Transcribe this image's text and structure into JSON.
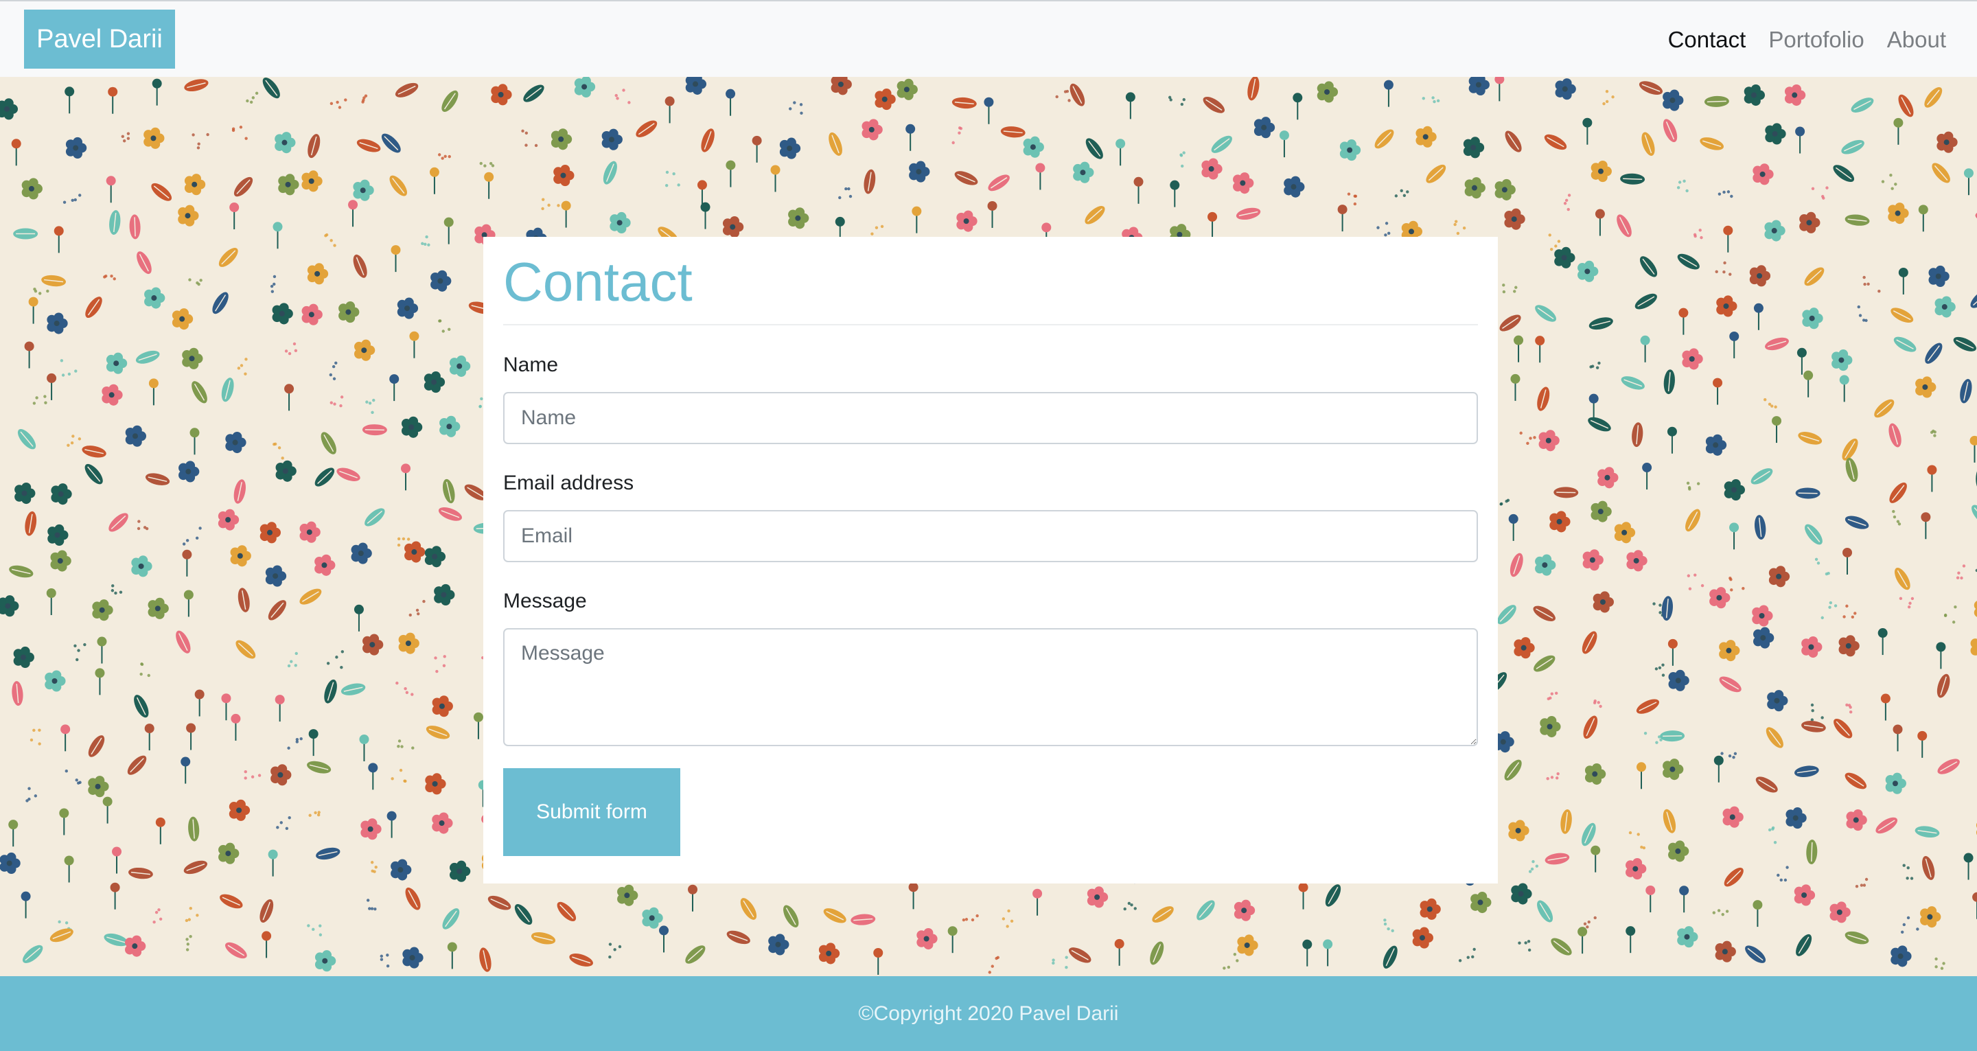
{
  "navbar": {
    "brand": "Pavel Darii",
    "links": [
      {
        "label": "Contact",
        "active": true
      },
      {
        "label": "Portofolio",
        "active": false
      },
      {
        "label": "About",
        "active": false
      }
    ]
  },
  "contact_form": {
    "title": "Contact",
    "name_label": "Name",
    "name_placeholder": "Name",
    "email_label": "Email address",
    "email_placeholder": "Email",
    "message_label": "Message",
    "message_placeholder": "Message",
    "submit_label": "Submit form"
  },
  "footer": {
    "copyright": "©Copyright 2020 Pavel Darii"
  },
  "colors": {
    "accent": "#6cbdd2",
    "navbar_bg": "#f8f9fa",
    "pattern_bg": "#f3ecde"
  },
  "background": {
    "pattern_name": "floral-pattern"
  }
}
